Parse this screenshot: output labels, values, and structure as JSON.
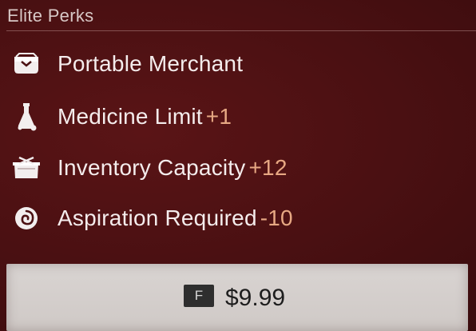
{
  "header": {
    "title": "Elite Perks"
  },
  "perks": [
    {
      "icon": "merchant-bag-icon",
      "label": "Portable Merchant",
      "bonus": ""
    },
    {
      "icon": "medicine-flask-icon",
      "label": "Medicine Limit",
      "bonus": "+1"
    },
    {
      "icon": "inventory-crate-icon",
      "label": "Inventory Capacity",
      "bonus": "+12"
    },
    {
      "icon": "aspiration-swirl-icon",
      "label": "Aspiration Required",
      "bonus": "-10"
    }
  ],
  "purchase": {
    "key": "F",
    "price": "$9.99"
  },
  "colors": {
    "background": "#4a1012",
    "bonus": "#e7a883",
    "text": "#f4ecec",
    "button": "#d9d4d2"
  }
}
